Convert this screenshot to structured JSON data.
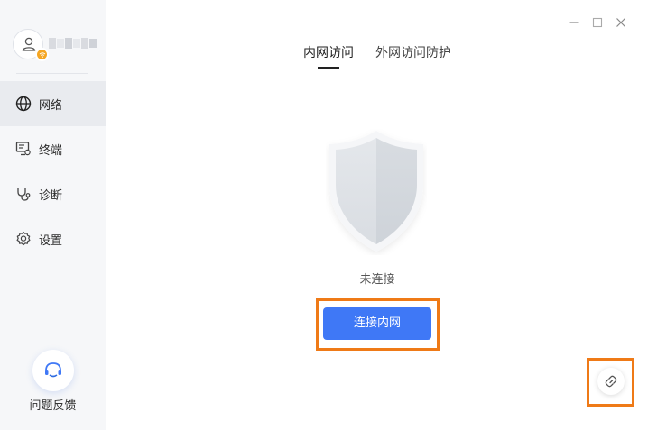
{
  "sidebar": {
    "user": {
      "avatar_icon": "user-icon",
      "badge_icon": "wifi-icon",
      "badge_color": "#f5a623"
    },
    "items": [
      {
        "label": "网络",
        "icon": "globe-icon",
        "active": true
      },
      {
        "label": "终端",
        "icon": "monitor-icon",
        "active": false
      },
      {
        "label": "诊断",
        "icon": "stethoscope-icon",
        "active": false
      },
      {
        "label": "设置",
        "icon": "gear-icon",
        "active": false
      }
    ],
    "feedback": {
      "label": "问题反馈",
      "icon": "headset-icon"
    }
  },
  "tabs": [
    {
      "label": "内网访问",
      "active": true
    },
    {
      "label": "外网访问防护",
      "active": false
    }
  ],
  "main": {
    "status_text": "未连接",
    "connect_button": "连接内网",
    "shield_icon": "shield-icon",
    "link_icon": "link-icon"
  },
  "colors": {
    "accent": "#3f78f6",
    "highlight": "#ef7a17"
  }
}
